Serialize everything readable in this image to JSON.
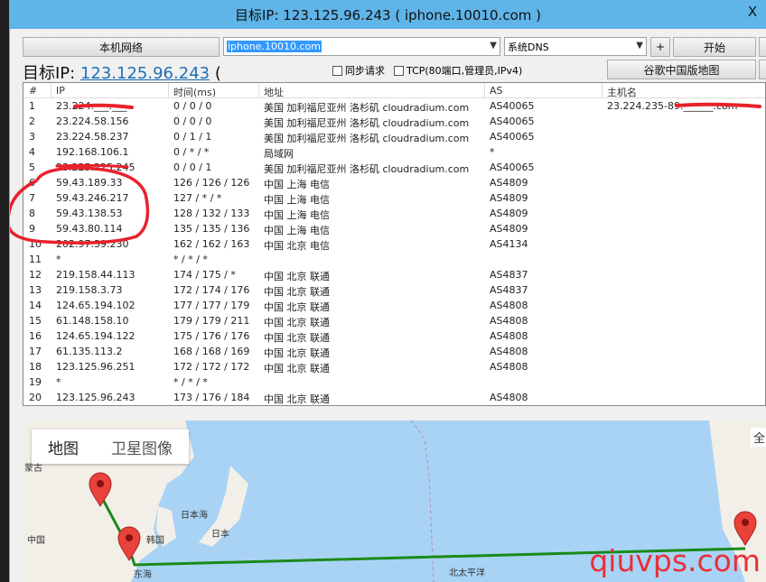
{
  "window": {
    "title": "目标IP: 123.125.96.243 ( iphone.10010.com )",
    "close": "X"
  },
  "toolbar": {
    "local_network_button": "本机网络",
    "host_input_value": "iphone.10010.com",
    "dns_select_value": "系统DNS",
    "plus_button": "+",
    "start_button": "开始",
    "google_map_button": "谷歌中国版地图"
  },
  "target": {
    "label": "目标IP: ",
    "ip": "123.125.96.243",
    "paren": " ("
  },
  "options": {
    "sync_request": "同步请求",
    "tcp": "TCP(80端口,管理员,IPv4)"
  },
  "table": {
    "headers": [
      "#",
      "IP",
      "时间(ms)",
      "地址",
      "AS",
      "主机名"
    ],
    "rows": [
      [
        "1",
        "23.224.___.___",
        "0 / 0 / 0",
        "美国 加利福尼亚州 洛杉矶 cloudradium.com",
        "AS40065",
        "23.224.235-89.______.com"
      ],
      [
        "2",
        "23.224.58.156",
        "0 / 0 / 0",
        "美国 加利福尼亚州 洛杉矶 cloudradium.com",
        "AS40065",
        ""
      ],
      [
        "3",
        "23.224.58.237",
        "0 / 1 / 1",
        "美国 加利福尼亚州 洛杉矶 cloudradium.com",
        "AS40065",
        ""
      ],
      [
        "4",
        "192.168.106.1",
        "0 / * / *",
        "局域网",
        "*",
        ""
      ],
      [
        "5",
        "23.225.225.245",
        "0 / 0 / 1",
        "美国 加利福尼亚州 洛杉矶 cloudradium.com",
        "AS40065",
        ""
      ],
      [
        "6",
        "59.43.189.33",
        "126 / 126 / 126",
        "中国 上海 电信",
        "AS4809",
        ""
      ],
      [
        "7",
        "59.43.246.217",
        "127 / * / *",
        "中国 上海 电信",
        "AS4809",
        ""
      ],
      [
        "8",
        "59.43.138.53",
        "128 / 132 / 133",
        "中国 上海 电信",
        "AS4809",
        ""
      ],
      [
        "9",
        "59.43.80.114",
        "135 / 135 / 136",
        "中国 上海 电信",
        "AS4809",
        ""
      ],
      [
        "10",
        "202.97.39.230",
        "162 / 162 / 163",
        "中国 北京 电信",
        "AS4134",
        ""
      ],
      [
        "11",
        "*",
        "* / * / *",
        "",
        "",
        ""
      ],
      [
        "12",
        "219.158.44.113",
        "174 / 175 / *",
        "中国 北京 联通",
        "AS4837",
        ""
      ],
      [
        "13",
        "219.158.3.73",
        "172 / 174 / 176",
        "中国 北京 联通",
        "AS4837",
        ""
      ],
      [
        "14",
        "124.65.194.102",
        "177 / 177 / 179",
        "中国 北京 联通",
        "AS4808",
        ""
      ],
      [
        "15",
        "61.148.158.10",
        "179 / 179 / 211",
        "中国 北京 联通",
        "AS4808",
        ""
      ],
      [
        "16",
        "124.65.194.122",
        "175 / 176 / 176",
        "中国 北京 联通",
        "AS4808",
        ""
      ],
      [
        "17",
        "61.135.113.2",
        "168 / 168 / 169",
        "中国 北京 联通",
        "AS4808",
        ""
      ],
      [
        "18",
        "123.125.96.251",
        "172 / 172 / 172",
        "中国 北京 联通",
        "AS4808",
        ""
      ],
      [
        "19",
        "*",
        "* / * / *",
        "",
        "",
        ""
      ],
      [
        "20",
        "123.125.96.243",
        "173 / 176 / 184",
        "中国 北京 联通",
        "AS4808",
        ""
      ]
    ]
  },
  "map": {
    "tab_map": "地图",
    "tab_satellite": "卫星图像",
    "labels": {
      "mongolia": "蒙古",
      "japan_sea": "日本海",
      "korea": "韩国",
      "japan": "日本",
      "china": "中国",
      "east_sea": "东海",
      "pacific": "北太平洋",
      "full": "全"
    },
    "route_color": "#1a8a1a"
  },
  "annotations": {
    "circle_color": "#e8222c"
  },
  "watermark": "qiuvps.com"
}
